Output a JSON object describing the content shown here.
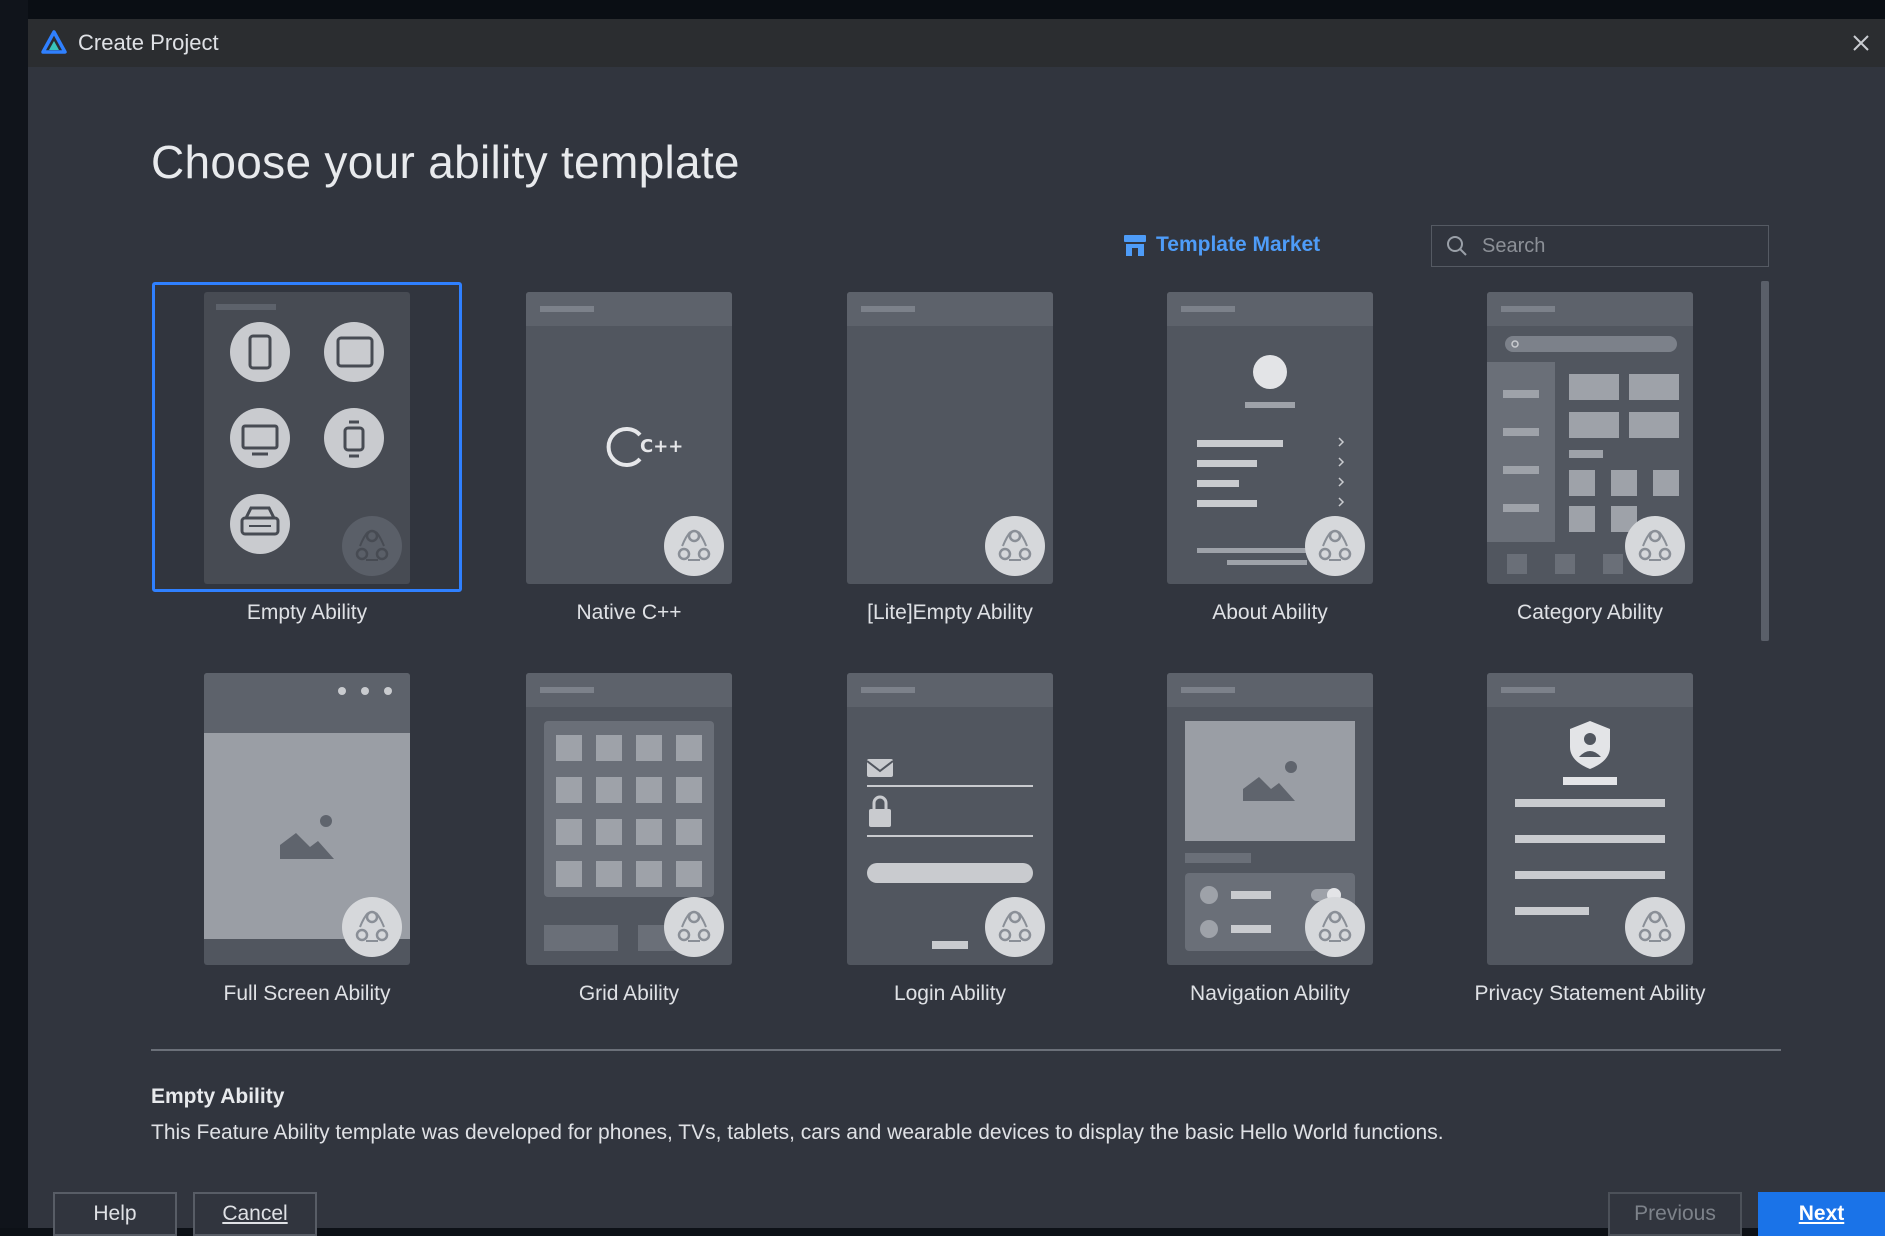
{
  "window": {
    "title": "Create Project"
  },
  "heading": "Choose your ability template",
  "template_market": {
    "label": "Template Market"
  },
  "search": {
    "placeholder": "Search",
    "value": ""
  },
  "templates": [
    {
      "label": "Empty Ability",
      "selected": true
    },
    {
      "label": "Native C++"
    },
    {
      "label": "[Lite]Empty Ability"
    },
    {
      "label": "About Ability"
    },
    {
      "label": "Category Ability"
    },
    {
      "label": "Full Screen Ability"
    },
    {
      "label": "Grid Ability"
    },
    {
      "label": "Login Ability"
    },
    {
      "label": "Navigation Ability"
    },
    {
      "label": "Privacy Statement Ability"
    }
  ],
  "native_cpp_glyph": "C++",
  "description": {
    "title": "Empty Ability",
    "body": "This Feature Ability template was developed for phones, TVs, tablets, cars and wearable devices to display the basic Hello World functions."
  },
  "buttons": {
    "help": "Help",
    "cancel": "Cancel",
    "previous": "Previous",
    "next": "Next"
  },
  "colors": {
    "accent": "#2f80ff",
    "link": "#4e9cf8",
    "primary_button": "#1a73e8",
    "window_bg": "#31353e",
    "title_bar": "#2b2d30"
  }
}
